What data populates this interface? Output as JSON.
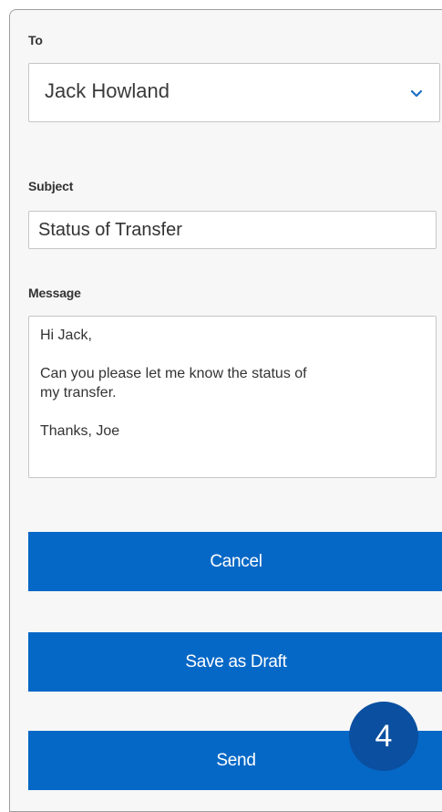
{
  "form": {
    "to_label": "To",
    "to_value": "Jack Howland",
    "subject_label": "Subject",
    "subject_value": "Status of Transfer",
    "message_label": "Message",
    "message_lines": {
      "greeting": "Hi Jack,",
      "body_line1": "Can you please let me know the status of",
      "body_line2": "my transfer.",
      "signoff": "Thanks, Joe"
    }
  },
  "buttons": {
    "cancel": "Cancel",
    "save_draft": "Save as Draft",
    "send": "Send"
  },
  "step_badge": "4",
  "icons": {
    "dropdown": "chevron-down-icon"
  },
  "colors": {
    "button_bg": "#0668c6",
    "badge_bg": "#0a4fa0",
    "chevron": "#1a6fc4"
  }
}
